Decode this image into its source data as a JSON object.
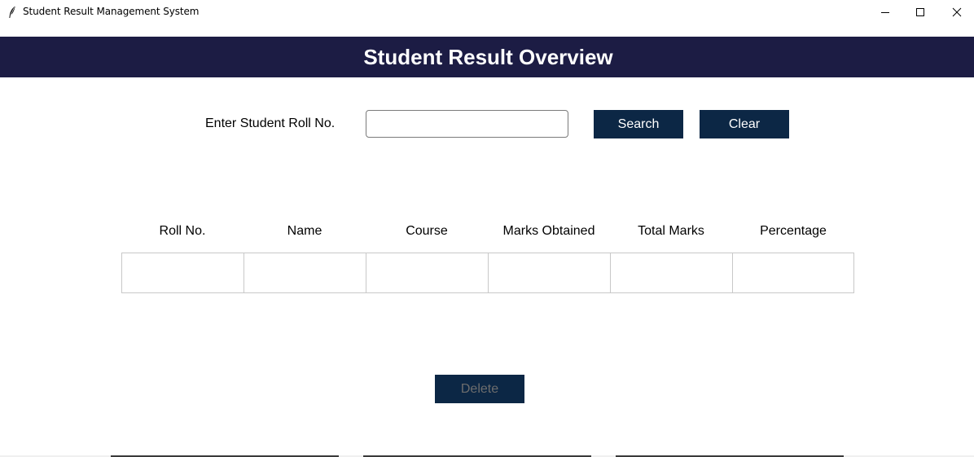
{
  "window": {
    "title": "Student Result Management System",
    "icon": "feather-icon",
    "controls": {
      "minimize_icon": "minimize-icon",
      "maximize_icon": "maximize-icon",
      "close_icon": "close-icon"
    }
  },
  "header": {
    "title": "Student Result Overview",
    "background_color": "#1c1c44"
  },
  "search": {
    "label": "Enter Student Roll No.",
    "input_value": "",
    "search_label": "Search",
    "clear_label": "Clear",
    "button_color": "#0c2745"
  },
  "table": {
    "columns": [
      "Roll No.",
      "Name",
      "Course",
      "Marks Obtained",
      "Total Marks",
      "Percentage"
    ],
    "row": [
      "",
      "",
      "",
      "",
      "",
      ""
    ]
  },
  "actions": {
    "delete_label": "Delete",
    "delete_disabled": true
  }
}
